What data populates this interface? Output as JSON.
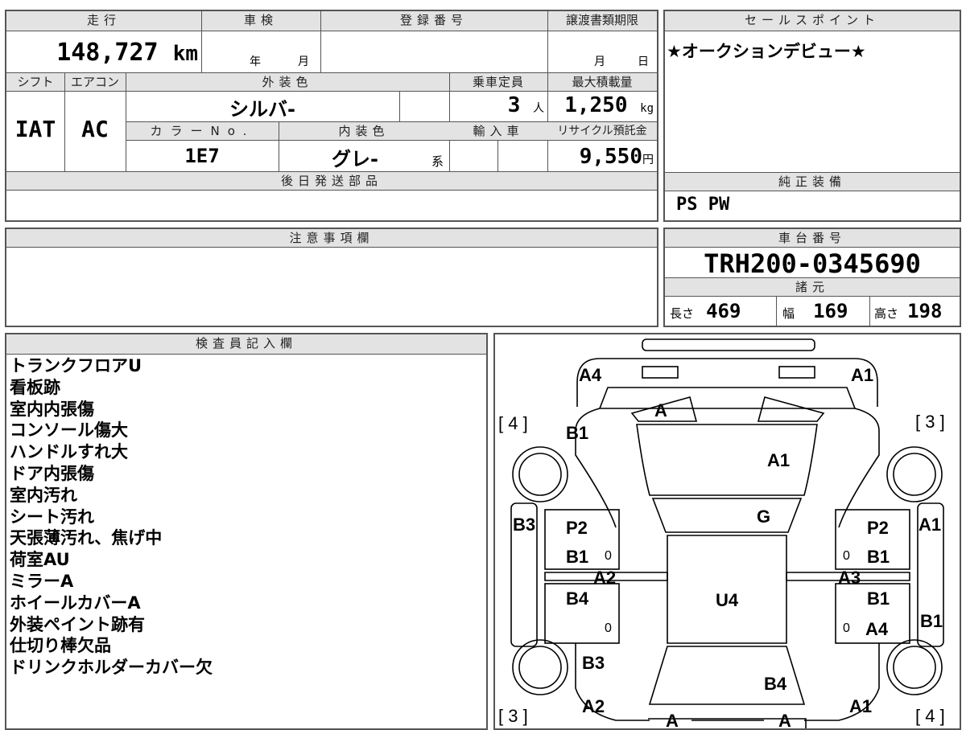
{
  "mileage": {
    "label": "走行",
    "value": "148,727",
    "unit": "km"
  },
  "inspection": {
    "label": "車検",
    "year_unit": "年",
    "month_unit": "月"
  },
  "registration": {
    "label": "登録番号"
  },
  "transfer_deadline": {
    "label": "譲渡書類期限",
    "month_unit": "月",
    "day_unit": "日"
  },
  "shift": {
    "label": "シフト",
    "value": "IAT"
  },
  "aircon": {
    "label": "エアコン",
    "value": "AC"
  },
  "exterior_color": {
    "label": "外装色",
    "value": "シルバ-"
  },
  "capacity": {
    "label": "乗車定員",
    "value": "3",
    "unit": "人"
  },
  "max_load": {
    "label": "最大積載量",
    "value": "1,250",
    "unit": "kg"
  },
  "color_no": {
    "label": "カラーNo.",
    "value": "1E7"
  },
  "interior_color": {
    "label": "内装色",
    "value": "グレ-",
    "suffix": "系"
  },
  "import_car": {
    "label": "輸入車"
  },
  "recycle_fee": {
    "label": "リサイクル預託金",
    "value": "9,550",
    "unit": "円"
  },
  "later_parts": {
    "label": "後日発送部品"
  },
  "sales_point": {
    "label": "セールスポイント",
    "value": "★オークションデビュー★"
  },
  "factory_equipment": {
    "label": "純正装備",
    "value": "PS PW"
  },
  "notes": {
    "label": "注意事項欄"
  },
  "chassis_no": {
    "label": "車台番号",
    "value": "TRH200-0345690"
  },
  "specs": {
    "label": "諸元",
    "length_label": "長さ",
    "length": "469",
    "width_label": "幅",
    "width": "169",
    "height_label": "高さ",
    "height": "198"
  },
  "inspector_remarks": {
    "label": "検査員記入欄",
    "items": [
      "トランクフロアU",
      "看板跡",
      "室内内張傷",
      "コンソール傷大",
      "ハンドルすれ大",
      "ドア内張傷",
      "室内汚れ",
      "シート汚れ",
      "天張薄汚れ、焦げ中",
      "荷室AU",
      "ミラーA",
      "ホイールカバーA",
      "外装ペイント跡有",
      "仕切り棒欠品",
      "ドリンクホルダーカバー欠"
    ]
  },
  "diagram": {
    "labels": {
      "front_left_corner": "A4",
      "front_right_corner": "A1",
      "windshield_top": "A",
      "bracket_left": "[ 4 ]",
      "bracket_right": "[ 3 ]",
      "left_front_fender": "B1",
      "windshield": "A1",
      "roof_front": "G",
      "left_side": "B3",
      "right_side": "A1",
      "left_door_p2": "P2",
      "left_door_b1": "B1",
      "left_door_zero1": "0",
      "left_sill": "A2",
      "left_door_b4": "B4",
      "left_door_zero2": "0",
      "right_door_p2": "P2",
      "right_door_b1": "B1",
      "right_door_zero1": "0",
      "right_sill": "A3",
      "right_door_b1b": "B1",
      "right_door_a4": "A4",
      "right_door_zero2": "0",
      "right_side_lower": "B1",
      "roof_center": "U4",
      "left_rear_fender": "B3",
      "rear_center": "B4",
      "rear_left_corner": "A2",
      "rear_right_corner": "A1",
      "bracket_left_bottom": "[ 3 ]",
      "bracket_right_bottom": "[ 4 ]",
      "bumper_left": "A",
      "bumper_right": "A"
    }
  }
}
